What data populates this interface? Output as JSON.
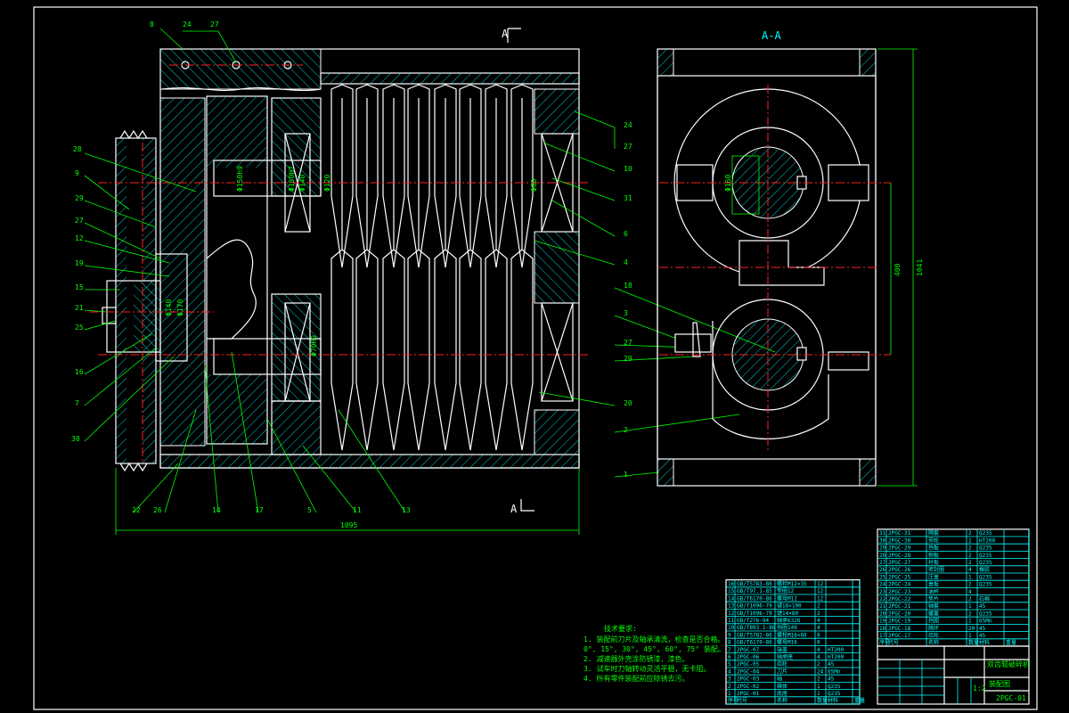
{
  "section_marks": {
    "a_top": "A",
    "a_bottom": "A",
    "section_title": "A-A"
  },
  "callouts_left": [
    "8",
    "24",
    "27",
    "28",
    "9",
    "29",
    "27",
    "12",
    "19",
    "15",
    "21",
    "25",
    "16",
    "7",
    "30",
    "22",
    "26",
    "14",
    "17",
    "5",
    "11",
    "13"
  ],
  "callouts_right": [
    "24",
    "27",
    "10",
    "31",
    "6",
    "4",
    "18",
    "3",
    "27",
    "29",
    "20",
    "2",
    "1"
  ],
  "dimensions": {
    "overall_length": "1095",
    "center_distance": "400",
    "overall_height": "1041",
    "dim_a": "Φ150h9",
    "dim_b": "Φ150H7",
    "dim_c": "Φ140",
    "dim_d": "Φ120",
    "dim_e": "Φ80",
    "dim_f": "Φ70H9",
    "dim_g": "Φ140",
    "dim_h": "Φ170",
    "dim_i": "Φ160"
  },
  "notes": {
    "title": "技术要求:",
    "lines": [
      "1. 装配前刀片及轴承清洗，检查是否合格。",
      "0°, 15°, 30°, 45°, 60°, 75° 装配。",
      "2. 减速器外壳涂防锈漆，漆色。",
      "3. 试车时刀轴转动灵活平稳，无卡阻。",
      "4. 所有零件装配前应除锈去污。"
    ]
  },
  "title_block": {
    "drawing_no": "2PGC-01",
    "scale": "1:2",
    "name": "双齿辊破碎机",
    "part_name": "装配图"
  },
  "bom_left": [
    {
      "no": "16",
      "code": "GB/T5783-86",
      "name": "螺栓M12×35",
      "qty": "12",
      "mat": "",
      "mass": ""
    },
    {
      "no": "15",
      "code": "GB/T97.1-85",
      "name": "垫圈12",
      "qty": "12",
      "mat": "",
      "mass": ""
    },
    {
      "no": "14",
      "code": "GB/T6170-86",
      "name": "螺母M12",
      "qty": "12",
      "mat": "",
      "mass": ""
    },
    {
      "no": "13",
      "code": "GB/T1096-79",
      "name": "键18×100",
      "qty": "2",
      "mat": "",
      "mass": ""
    },
    {
      "no": "12",
      "code": "GB/T1096-79",
      "name": "键14×80",
      "qty": "2",
      "mat": "",
      "mass": ""
    },
    {
      "no": "11",
      "code": "GB/T276-94",
      "name": "轴承6326",
      "qty": "4",
      "mat": "",
      "mass": ""
    },
    {
      "no": "10",
      "code": "GB/T893.1-86",
      "name": "挡圈140",
      "qty": "4",
      "mat": "",
      "mass": ""
    },
    {
      "no": "9",
      "code": "GB/T5782-86",
      "name": "螺栓M16×60",
      "qty": "8",
      "mat": "",
      "mass": ""
    },
    {
      "no": "8",
      "code": "GB/T6170-86",
      "name": "螺母M16",
      "qty": "8",
      "mat": "",
      "mass": ""
    },
    {
      "no": "7",
      "code": "2PGC-07",
      "name": "端盖",
      "qty": "4",
      "mat": "HT200",
      "mass": ""
    },
    {
      "no": "6",
      "code": "2PGC-06",
      "name": "轴承座",
      "qty": "4",
      "mat": "HT200",
      "mass": ""
    },
    {
      "no": "5",
      "code": "2PGC-05",
      "name": "齿轮",
      "qty": "2",
      "mat": "45",
      "mass": ""
    },
    {
      "no": "4",
      "code": "2PGC-04",
      "name": "刀片",
      "qty": "24",
      "mat": "65Mn",
      "mass": ""
    },
    {
      "no": "3",
      "code": "2PGC-03",
      "name": "轴",
      "qty": "2",
      "mat": "45",
      "mass": ""
    },
    {
      "no": "2",
      "code": "2PGC-02",
      "name": "箱体",
      "qty": "1",
      "mat": "Q235",
      "mass": ""
    },
    {
      "no": "1",
      "code": "2PGC-01",
      "name": "底座",
      "qty": "1",
      "mat": "Q235",
      "mass": ""
    }
  ],
  "bom_right": [
    {
      "no": "31",
      "code": "2PGC-31",
      "name": "隔套",
      "qty": "2",
      "mat": "Q235",
      "mass": ""
    },
    {
      "no": "30",
      "code": "2PGC-30",
      "name": "带轮",
      "qty": "1",
      "mat": "HT200",
      "mass": ""
    },
    {
      "no": "29",
      "code": "2PGC-29",
      "name": "挡板",
      "qty": "2",
      "mat": "Q235",
      "mass": ""
    },
    {
      "no": "28",
      "code": "2PGC-28",
      "name": "侧板",
      "qty": "2",
      "mat": "Q235",
      "mass": ""
    },
    {
      "no": "27",
      "code": "2PGC-27",
      "name": "衬板",
      "qty": "2",
      "mat": "Q235",
      "mass": ""
    },
    {
      "no": "26",
      "code": "2PGC-26",
      "name": "密封圈",
      "qty": "4",
      "mat": "橡胶",
      "mass": ""
    },
    {
      "no": "25",
      "code": "2PGC-25",
      "name": "压盖",
      "qty": "1",
      "mat": "Q235",
      "mass": ""
    },
    {
      "no": "24",
      "code": "2PGC-24",
      "name": "盖板",
      "qty": "2",
      "mat": "Q235",
      "mass": ""
    },
    {
      "no": "23",
      "code": "2PGC-23",
      "name": "油杯",
      "qty": "4",
      "mat": "",
      "mass": ""
    },
    {
      "no": "22",
      "code": "2PGC-22",
      "name": "垫片",
      "qty": "2",
      "mat": "石棉",
      "mass": ""
    },
    {
      "no": "21",
      "code": "2PGC-21",
      "name": "轴套",
      "qty": "1",
      "mat": "45",
      "mass": ""
    },
    {
      "no": "20",
      "code": "2PGC-20",
      "name": "螺塞",
      "qty": "2",
      "mat": "Q235",
      "mass": ""
    },
    {
      "no": "19",
      "code": "2PGC-19",
      "name": "挡圈",
      "qty": "1",
      "mat": "65Mn",
      "mass": ""
    },
    {
      "no": "18",
      "code": "2PGC-18",
      "name": "隔环",
      "qty": "20",
      "mat": "45",
      "mass": ""
    },
    {
      "no": "17",
      "code": "2PGC-17",
      "name": "齿轮",
      "qty": "1",
      "mat": "45",
      "mass": ""
    }
  ],
  "bom_header": {
    "no": "序号",
    "code": "代号",
    "name": "名称",
    "qty": "数量",
    "mat": "材料",
    "mass": "重量"
  }
}
